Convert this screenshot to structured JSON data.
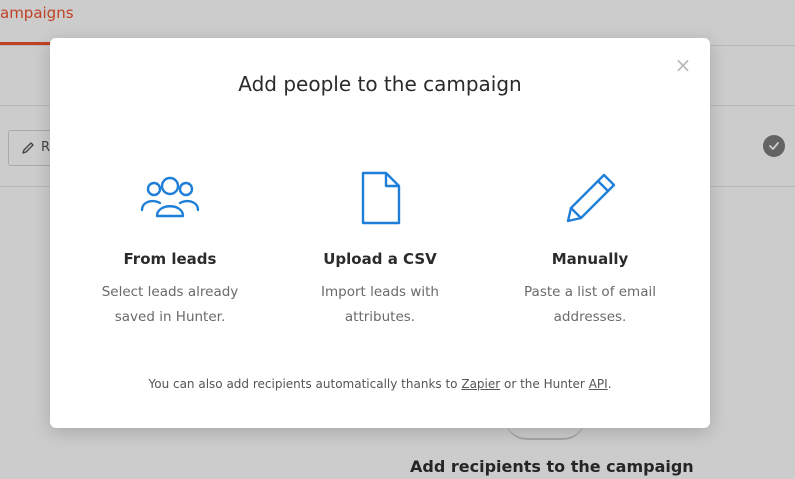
{
  "background": {
    "tab_label": "ampaigns",
    "edit_button_label": "R",
    "recipients_title": "Add recipients to the campaign"
  },
  "modal": {
    "title": "Add people to the campaign",
    "close_label": "×",
    "options": [
      {
        "title": "From leads",
        "description": "Select leads already saved in Hunter.",
        "icon": "users-icon"
      },
      {
        "title": "Upload a CSV",
        "description": "Import leads with attributes.",
        "icon": "file-icon"
      },
      {
        "title": "Manually",
        "description": "Paste a list of email addresses.",
        "icon": "pencil-icon"
      }
    ],
    "footer": {
      "prefix": "You can also add recipients automatically thanks to",
      "zapier_link": "Zapier",
      "middle": "or the Hunter",
      "api_link": "API",
      "suffix": "."
    }
  },
  "colors": {
    "accent": "#f0532f",
    "icon_blue": "#1f7fd8"
  }
}
